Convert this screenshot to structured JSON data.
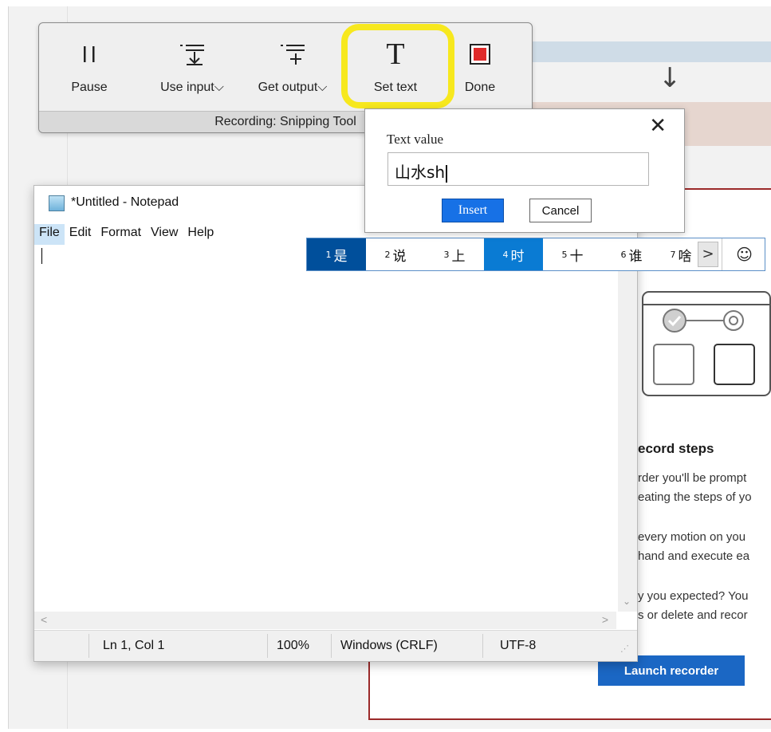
{
  "toolbar": {
    "buttons": [
      {
        "label": "Pause",
        "icon": "pause-icon"
      },
      {
        "label": "Use input",
        "icon": "use-input-icon"
      },
      {
        "label": "Get output",
        "icon": "get-output-icon"
      },
      {
        "label": "Set text",
        "icon": "text-t-icon"
      },
      {
        "label": "Done",
        "icon": "stop-icon"
      }
    ],
    "status": "Recording: Snipping Tool",
    "colors": {
      "highlight": "#f7e81e",
      "stop": "#e02a2a"
    }
  },
  "dialog": {
    "label": "Text value",
    "input_value": "山水sh",
    "insert_label": "Insert",
    "cancel_label": "Cancel"
  },
  "notepad": {
    "title": "*Untitled - Notepad",
    "menu": [
      "File",
      "Edit",
      "Format",
      "View",
      "Help"
    ],
    "status": {
      "position": "Ln 1, Col 1",
      "zoom": "100%",
      "line_ending": "Windows (CRLF)",
      "encoding": "UTF-8"
    }
  },
  "ime": {
    "candidates": [
      {
        "num": "1",
        "text": "是"
      },
      {
        "num": "2",
        "text": "说"
      },
      {
        "num": "3",
        "text": "上"
      },
      {
        "num": "4",
        "text": "时"
      },
      {
        "num": "5",
        "text": "十"
      },
      {
        "num": "6",
        "text": "谁"
      },
      {
        "num": "7",
        "text": "啥"
      }
    ],
    "more": ">",
    "emoji": "☺"
  },
  "background_panel": {
    "heading": "ecord steps",
    "lines": [
      "rder you'll be prompt",
      "eating the steps of yo",
      "every motion on you",
      "hand and execute ea",
      "y you expected? You",
      "s or delete and recor"
    ],
    "launch_label": "Launch recorder",
    "accent": "#1b67c4"
  }
}
